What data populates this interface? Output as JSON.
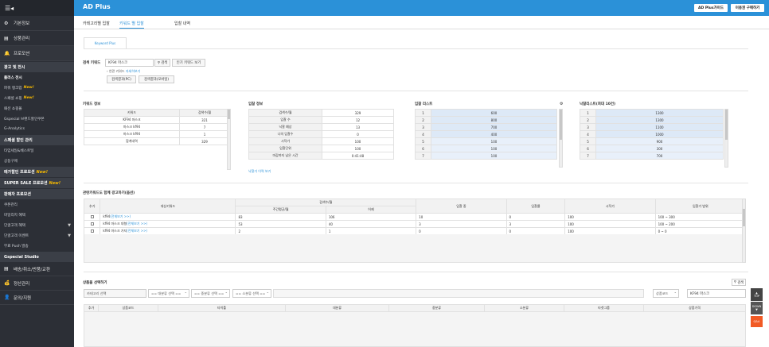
{
  "app": {
    "title": "AD Plus",
    "btn_guide": "AD Plus가이드",
    "btn_buy": "이용권 구매하기"
  },
  "sidebar": {
    "top_icon": "☰◂",
    "main": [
      {
        "icon": "⚙",
        "label": "기본정보"
      },
      {
        "icon": "▤",
        "label": "상품관리"
      },
      {
        "icon": "🔔",
        "label": "프로모션"
      }
    ],
    "sections": [
      {
        "title": "광고 및 전시",
        "items": [
          {
            "label": "플러스 전시",
            "sel": true,
            "new": false
          },
          {
            "label": "파워 랭크업",
            "new": true
          },
          {
            "label": "스페셜 쇼핑",
            "new": true
          },
          {
            "label": "패션 쇼핑몰",
            "new": false
          },
          {
            "label": "Gspecial 브랜드할인쿠폰",
            "new": false
          },
          {
            "label": "G-Analytics",
            "new": false
          }
        ]
      },
      {
        "title": "스페셜 할인 관리",
        "items": [
          {
            "label": "타임세일&베스트딜",
            "new": false
          },
          {
            "label": "공동구매",
            "new": false
          }
        ]
      },
      {
        "title": "메가할인 프로모션",
        "new": true,
        "items": []
      },
      {
        "title": "SUPER SALE 프로모션",
        "new": true,
        "items": []
      },
      {
        "title": "판매자 프로모션",
        "items": [
          {
            "label": "쿠폰관리",
            "new": false
          },
          {
            "label": "마일리지 혜택",
            "new": false
          },
          {
            "label": "단골고객 혜택",
            "arrow": "▼"
          },
          {
            "label": "단골고객 이벤트",
            "arrow": "▼"
          },
          {
            "label": "무료 Push 발송",
            "new": false
          }
        ]
      },
      {
        "title": "Gspecial Studio",
        "items": []
      }
    ],
    "bottom": [
      {
        "icon": "▤",
        "label": "배송/취소/반품/교환"
      },
      {
        "icon": "💰",
        "label": "정산관리"
      },
      {
        "icon": "👤",
        "label": "문의/지원"
      }
    ],
    "new_label": "New!"
  },
  "tabs": [
    "카테고리별 입찰",
    "키워드 별 입찰",
    "입찰 내역"
  ],
  "subtab": "Keyword Plus",
  "search": {
    "label": "검색 키워드",
    "value": "KF94 마스크",
    "btn_search": "검색",
    "btn_popular": "인기 키워드 보기",
    "related_prefix": "연관 키워드",
    "related_link": "자세히보기",
    "btn_pc": "검색결과(PC)",
    "btn_mobile": "검색결과(모바일)"
  },
  "kw_info": {
    "title": "키워드 정보",
    "headers": [
      "키워드",
      "검색수/월"
    ],
    "rows": [
      [
        "KF94 마스크",
        "321"
      ],
      [
        "마스크 kf94",
        "7"
      ],
      [
        "마스크 kf94",
        "1"
      ],
      [
        "합계내역",
        "329"
      ]
    ]
  },
  "bid_info": {
    "title": "입찰 정보",
    "rows": [
      [
        "검색수/월",
        "329"
      ],
      [
        "입찰 수",
        "12"
      ],
      [
        "낙찰 예상",
        "13"
      ],
      [
        "나의 입찰수",
        "0"
      ],
      [
        "시작가",
        "100"
      ],
      [
        "입찰단위",
        "100"
      ],
      [
        "마감까지 남은 시간",
        "0:41:48"
      ]
    ],
    "more": "낙찰가 이력 보기"
  },
  "bid_list": {
    "title": "입찰 리스트",
    "rows": [
      [
        "1",
        "600"
      ],
      [
        "2",
        "800"
      ],
      [
        "3",
        "700"
      ],
      [
        "4",
        "400"
      ],
      [
        "5",
        "100"
      ],
      [
        "6",
        "100"
      ],
      [
        "7",
        "100"
      ]
    ]
  },
  "win_list": {
    "title": "낙찰리스트(최대 10건)",
    "rows": [
      [
        "1",
        "1300"
      ],
      [
        "2",
        "1300"
      ],
      [
        "3",
        "1100"
      ],
      [
        "4",
        "1000"
      ],
      [
        "5",
        "900"
      ],
      [
        "6",
        "300"
      ],
      [
        "7",
        "700"
      ]
    ]
  },
  "related": {
    "title": "관련키워드도 함께 광고하기(옵션)",
    "h_add": "추가",
    "h_target": "대상키워드",
    "h_search": "검색수/월",
    "h_avg": "주간평균/월",
    "h_total": "어제",
    "h_bidcount": "입찰 중",
    "h_rate": "입찰률",
    "h_start": "시작가",
    "h_range": "입찰가 범위",
    "rows": [
      {
        "kw": "kf94",
        "more": "(전체보기 >>)",
        "avg": "83",
        "total": "106",
        "bid": "10",
        "rate": "0",
        "start": "100",
        "range": "100 ~ 300"
      },
      {
        "kw": "kf94 마스크 대형",
        "more": "(전체보기 >>)",
        "avg": "53",
        "total": "40",
        "bid": "3",
        "rate": "3",
        "start": "100",
        "range": "100 ~ 200"
      },
      {
        "kw": "kf94 마스크 가지",
        "more": "(전체보기 >>)",
        "avg": "2",
        "total": "1",
        "bid": "0",
        "rate": "0",
        "start": "100",
        "range": "0 ~ 0"
      }
    ]
  },
  "products": {
    "title": "상품을 선택하기",
    "search_btn": "검색",
    "cat_label": "카테고리 선택",
    "sel1": "== 대분류 선택 ==",
    "sel2": "== 중분류 선택 ==",
    "sel3": "== 소분류 선택 ==",
    "code_sel": "상품코드",
    "code_value": "KF94 마스크",
    "headers": [
      "추가",
      "상품코드",
      "타이틀",
      "대분류",
      "중분류",
      "소분류",
      "타겟그룹",
      "상품가격"
    ]
  },
  "fab": {
    "top": "TOP",
    "down": "DOWN",
    "qa": "Q&A"
  }
}
